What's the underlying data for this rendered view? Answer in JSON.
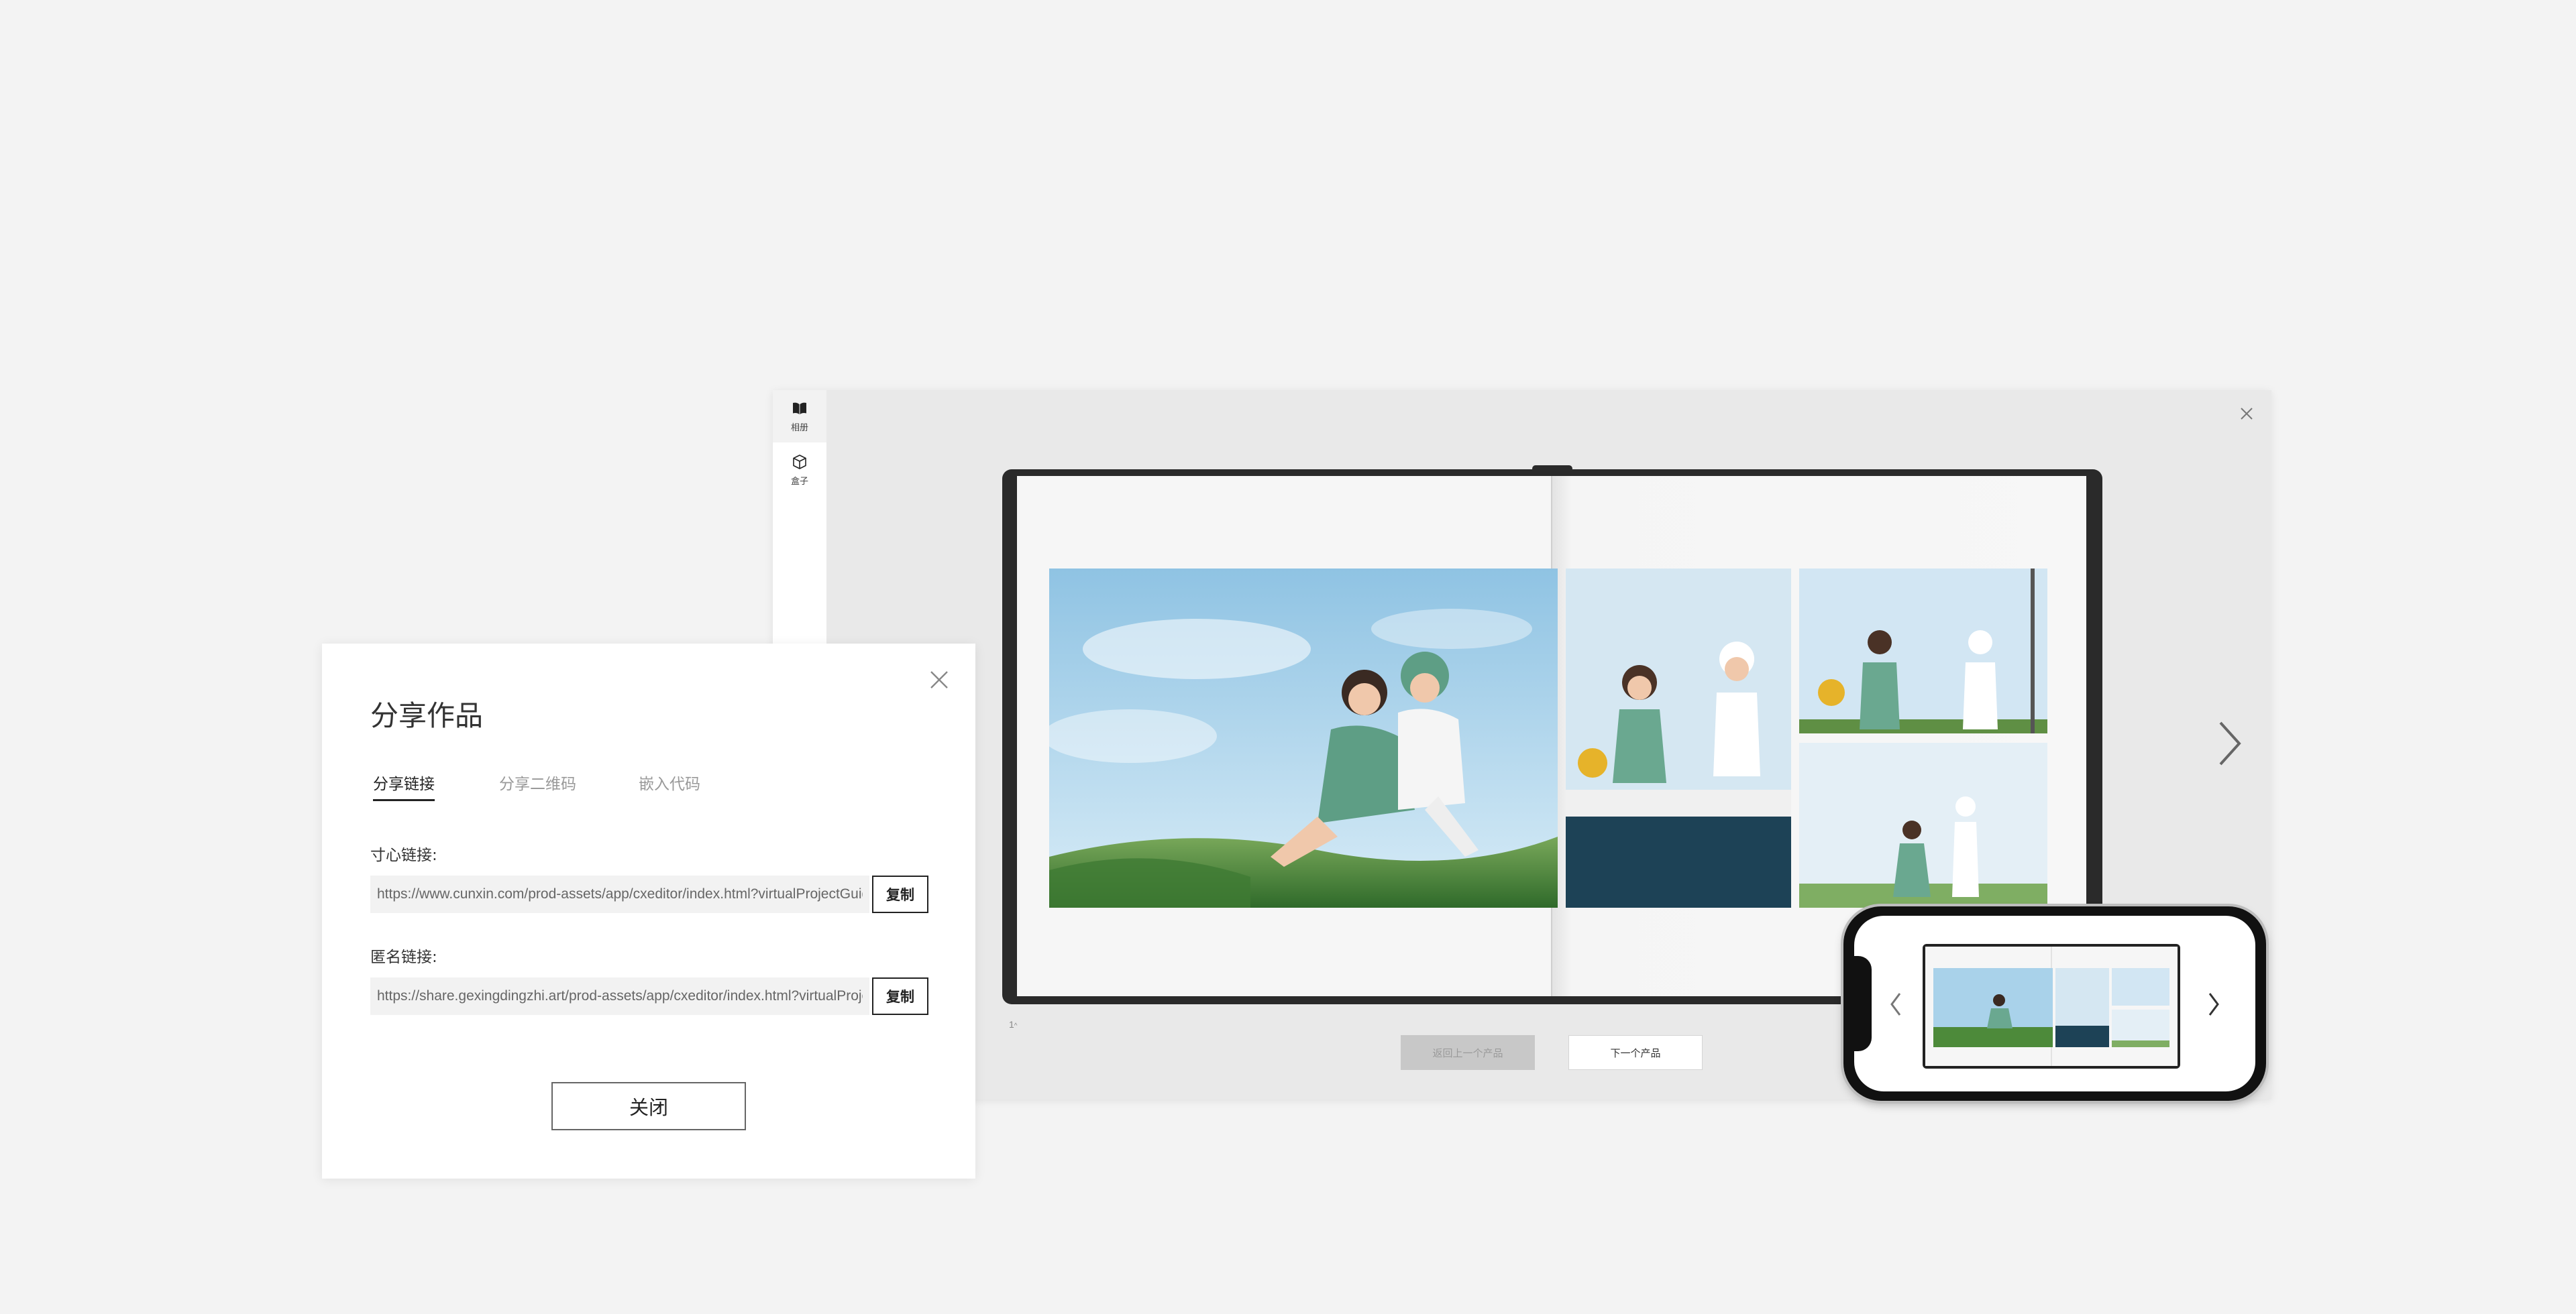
{
  "sidebar": {
    "items": [
      {
        "label": "相册",
        "icon": "book-icon"
      },
      {
        "label": "盒子",
        "icon": "box-icon"
      }
    ]
  },
  "preview": {
    "page_indicator": "1",
    "prev_label": "返回上一个产品",
    "next_label": "下一个产品"
  },
  "share_dialog": {
    "title": "分享作品",
    "tabs": [
      {
        "label": "分享链接",
        "active": true
      },
      {
        "label": "分享二维码",
        "active": false
      },
      {
        "label": "嵌入代码",
        "active": false
      }
    ],
    "cunxin_link": {
      "label": "寸心链接:",
      "value": "https://www.cunxin.com/prod-assets/app/cxeditor/index.html?virtualProjectGuid=",
      "copy_label": "复制"
    },
    "anon_link": {
      "label": "匿名链接:",
      "value": "https://share.gexingdingzhi.art/prod-assets/app/cxeditor/index.html?virtualProjectGuid=",
      "copy_label": "复制"
    },
    "close_label": "关闭"
  },
  "colors": {
    "background": "#f3f3f3",
    "preview_bg": "#e9e9e9",
    "album_cover": "#2a2a2a",
    "sky": "#a9d2ea",
    "grass": "#4d8a3a",
    "outfit_green": "#6aa890",
    "prev_button_bg": "#c8c8c8"
  }
}
